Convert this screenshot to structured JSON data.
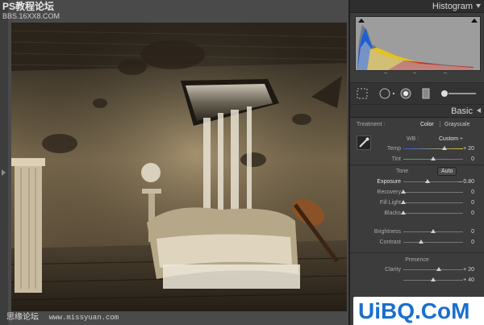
{
  "watermark": {
    "top_title": "PS教程论坛",
    "top_url": "BBS.16XX8.COM",
    "bottom_title": "思缘论坛",
    "bottom_url": "www.missyuan.com"
  },
  "logo": {
    "text": "UiBQ.CoM"
  },
  "panels": {
    "histogram": {
      "title": "Histogram"
    },
    "basic": {
      "title": "Basic"
    }
  },
  "treatment": {
    "label": "Treatment :",
    "color": "Color",
    "grayscale": "Grayscale"
  },
  "wb": {
    "label": "WB :",
    "value": "Custom ÷"
  },
  "temp": {
    "label": "Temp",
    "value": "+ 20",
    "level": 0.69
  },
  "tint": {
    "label": "Tint",
    "value": "0",
    "level": 0.5
  },
  "tone": {
    "label": "Tone",
    "auto": "Auto"
  },
  "exposure": {
    "label": "Exposure",
    "value": "– 0.80",
    "level": 0.4
  },
  "recovery": {
    "label": "Recovery",
    "value": "0",
    "level": 0.0
  },
  "fill_light": {
    "label": "Fill Light",
    "value": "0",
    "level": 0.0
  },
  "blacks": {
    "label": "Blacks",
    "value": "0",
    "level": 0.0
  },
  "brightness": {
    "label": "Brightness",
    "value": "0",
    "level": 0.5
  },
  "contrast": {
    "label": "Contrast",
    "value": "0",
    "level": 0.3
  },
  "presence": {
    "label": "Presence"
  },
  "clarity": {
    "label": "Clarity",
    "value": "+ 20",
    "level": 0.6
  },
  "vibrance": {
    "label": "",
    "value": "+ 40",
    "level": 0.5
  },
  "colors": {
    "accent": "#1a6fd0",
    "panel": "#3c3c3c",
    "histogram_bg": "#9d9d9d"
  }
}
